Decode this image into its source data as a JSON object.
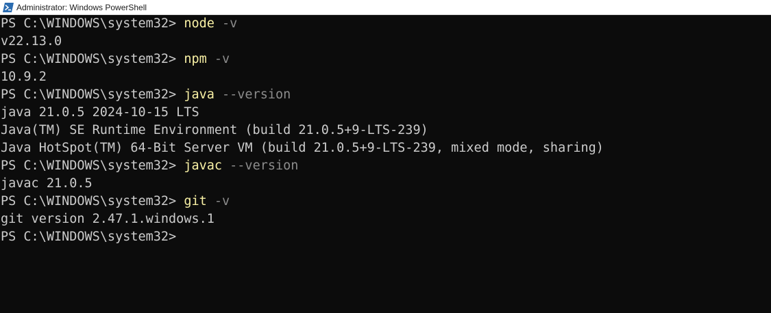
{
  "window": {
    "title": "Administrator: Windows PowerShell"
  },
  "console": {
    "prompt": "PS C:\\WINDOWS\\system32> ",
    "lines": [
      {
        "type": "command",
        "cmd": "node",
        "arg": " -v"
      },
      {
        "type": "output",
        "text": "v22.13.0"
      },
      {
        "type": "command",
        "cmd": "npm",
        "arg": " -v"
      },
      {
        "type": "output",
        "text": "10.9.2"
      },
      {
        "type": "command",
        "cmd": "java",
        "arg": " --version"
      },
      {
        "type": "output",
        "text": "java 21.0.5 2024-10-15 LTS"
      },
      {
        "type": "output",
        "text": "Java(TM) SE Runtime Environment (build 21.0.5+9-LTS-239)"
      },
      {
        "type": "output",
        "text": "Java HotSpot(TM) 64-Bit Server VM (build 21.0.5+9-LTS-239, mixed mode, sharing)"
      },
      {
        "type": "command",
        "cmd": "javac",
        "arg": " --version"
      },
      {
        "type": "output",
        "text": "javac 21.0.5"
      },
      {
        "type": "command",
        "cmd": "git",
        "arg": " -v"
      },
      {
        "type": "output",
        "text": "git version 2.47.1.windows.1"
      },
      {
        "type": "prompt"
      }
    ]
  },
  "colors": {
    "background": "#0c0c0c",
    "text": "#cccccc",
    "command": "#f9f1a5",
    "argument": "#8c8c8c"
  },
  "icons": {
    "app_icon": "powershell-icon"
  }
}
